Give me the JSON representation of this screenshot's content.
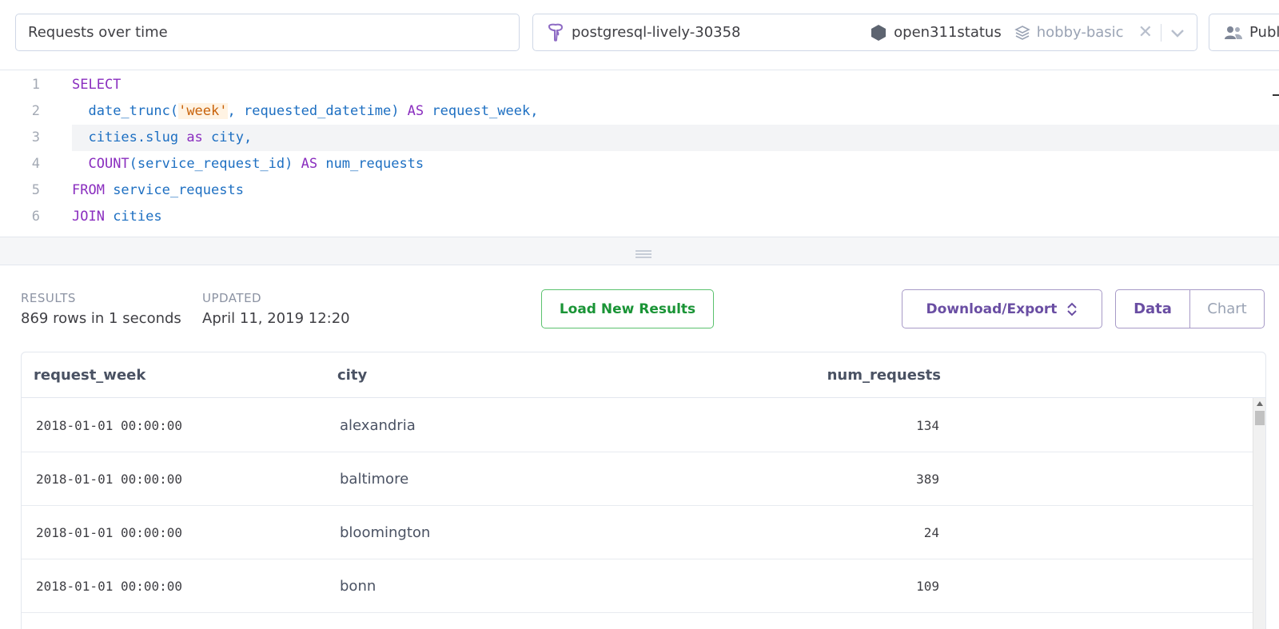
{
  "query": {
    "title": "Requests over time"
  },
  "datasource": {
    "database_name": "postgresql-lively-30358",
    "app_name": "open311status",
    "plan_name": "hobby-basic",
    "clear_glyph": "✕"
  },
  "share": {
    "label": "Publ"
  },
  "editor": {
    "lines": [
      {
        "no": "1"
      },
      {
        "no": "2"
      },
      {
        "no": "3"
      },
      {
        "no": "4"
      },
      {
        "no": "5"
      },
      {
        "no": "6"
      }
    ],
    "tokens": {
      "select": "SELECT",
      "date_trunc": "date_trunc(",
      "week": "'week'",
      "requested": ", requested_datetime) ",
      "as1": "AS",
      "request_week": " request_week,",
      "cities_slug": "cities.slug ",
      "as2": "as",
      "city": " city,",
      "count": "COUNT",
      "service_request_id": "(service_request_id) ",
      "as3": "AS",
      "num_requests": " num_requests",
      "from": "FROM",
      "service_requests": " service_requests",
      "join": "JOIN",
      "cities": " cities"
    }
  },
  "results": {
    "label": "RESULTS",
    "value": "869 rows in 1 seconds",
    "updated_label": "UPDATED",
    "updated_value": "April 11, 2019 12:20",
    "load_button": "Load New Results",
    "export_button": "Download/Export",
    "view_data": "Data",
    "view_chart": "Chart"
  },
  "table": {
    "columns": [
      "request_week",
      "city",
      "num_requests"
    ],
    "rows": [
      [
        "2018-01-01 00:00:00",
        "alexandria",
        "134"
      ],
      [
        "2018-01-01 00:00:00",
        "baltimore",
        "389"
      ],
      [
        "2018-01-01 00:00:00",
        "bloomington",
        "24"
      ],
      [
        "2018-01-01 00:00:00",
        "bonn",
        "109"
      ]
    ]
  },
  "colors": {
    "accent": "#6a4ea3",
    "success": "#1a9436",
    "keyword": "#8a2ebf",
    "identifier": "#1d6fc2",
    "string": "#c8620a"
  },
  "icons": {
    "database": "postgres-elephant-icon",
    "app": "hexagon-app-icon",
    "plan": "layers-icon",
    "clear": "close-icon",
    "dropdown": "chevron-down-icon",
    "share": "people-icon",
    "resize": "drag-grip-icon",
    "export": "up-down-chevron-icon"
  }
}
